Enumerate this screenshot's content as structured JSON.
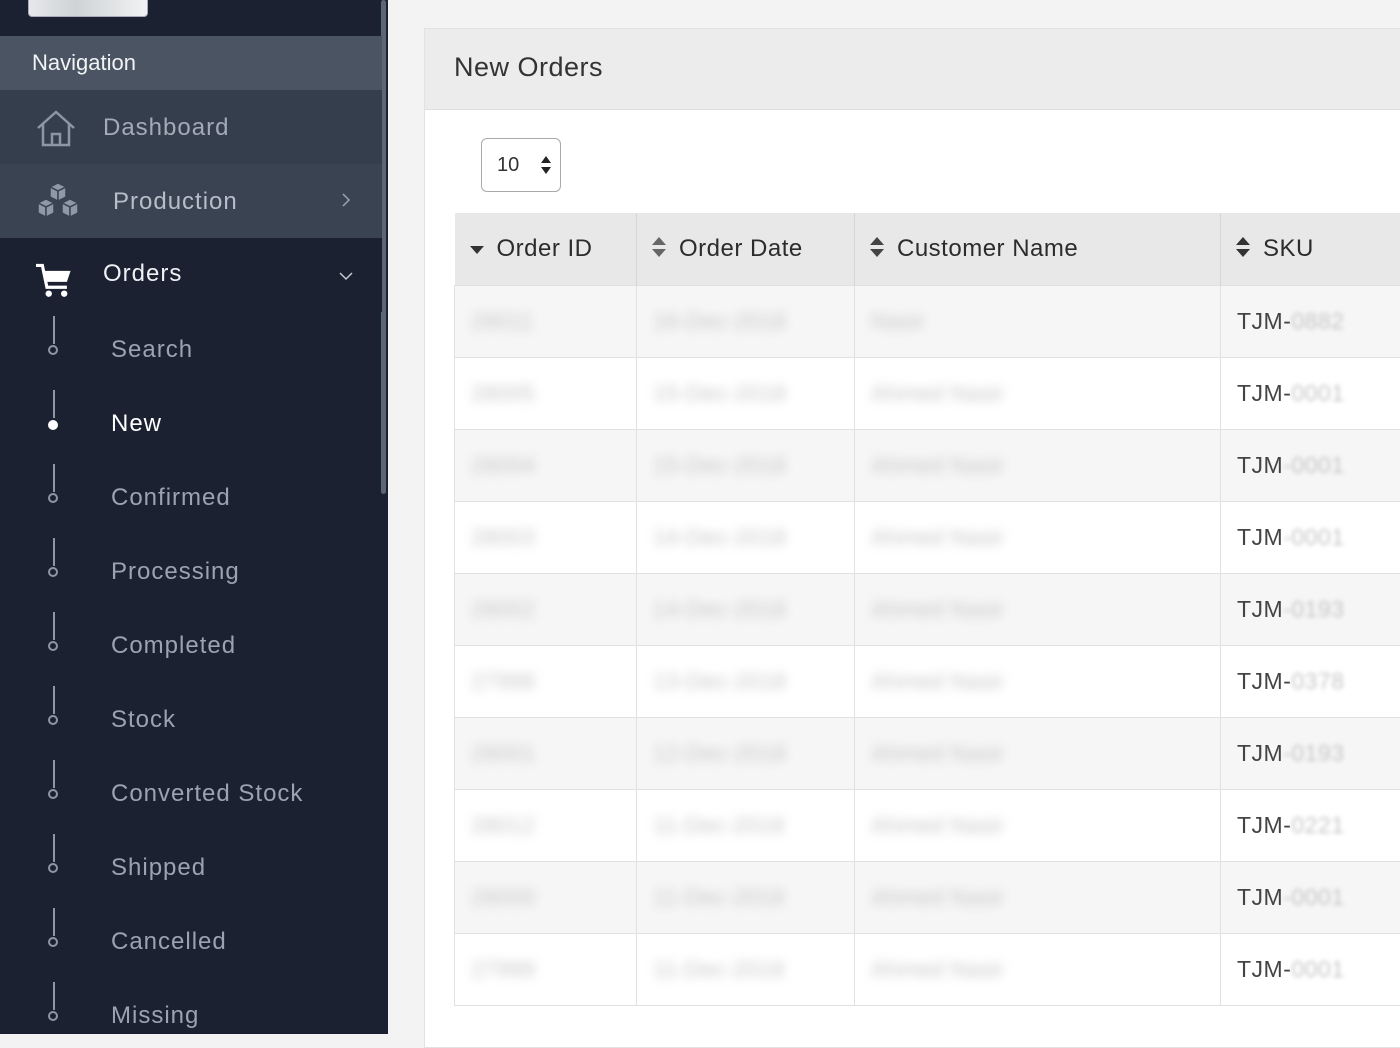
{
  "sidebar": {
    "header": "Navigation",
    "items": [
      {
        "label": "Dashboard",
        "icon": "home-icon"
      },
      {
        "label": "Production",
        "icon": "cubes-icon"
      },
      {
        "label": "Orders",
        "icon": "cart-icon",
        "expanded": true
      }
    ],
    "orders_sub": [
      {
        "label": "Search",
        "active": false
      },
      {
        "label": "New",
        "active": true
      },
      {
        "label": "Confirmed",
        "active": false
      },
      {
        "label": "Processing",
        "active": false
      },
      {
        "label": "Completed",
        "active": false
      },
      {
        "label": "Stock",
        "active": false
      },
      {
        "label": "Converted Stock",
        "active": false
      },
      {
        "label": "Shipped",
        "active": false
      },
      {
        "label": "Cancelled",
        "active": false
      },
      {
        "label": "Missing",
        "active": false
      }
    ]
  },
  "panel": {
    "title": "New Orders",
    "page_size": "10"
  },
  "table": {
    "columns": [
      "Order ID",
      "Order Date",
      "Customer Name",
      "SKU"
    ],
    "rows": [
      {
        "id": "28011",
        "date": "16-Dec-2018",
        "customer": "Nasir",
        "sku_prefix": "TJM-",
        "sku_tail": "0882"
      },
      {
        "id": "28005",
        "date": "15-Dec-2018",
        "customer": "Ahmed Nasir",
        "sku_prefix": "TJM-",
        "sku_tail": "0001"
      },
      {
        "id": "28004",
        "date": "15-Dec-2018",
        "customer": "Ahmed Nasir",
        "sku_prefix": "TJM",
        "sku_tail": "-0001"
      },
      {
        "id": "28003",
        "date": "14-Dec-2018",
        "customer": "Ahmed Nasir",
        "sku_prefix": "TJM",
        "sku_tail": "-0001"
      },
      {
        "id": "28002",
        "date": "14-Dec-2018",
        "customer": "Ahmed Nasir",
        "sku_prefix": "TJM",
        "sku_tail": "-0193"
      },
      {
        "id": "27998",
        "date": "13-Dec-2018",
        "customer": "Ahmed Nasir",
        "sku_prefix": "TJM-",
        "sku_tail": "0378"
      },
      {
        "id": "28001",
        "date": "12-Dec-2018",
        "customer": "Ahmed Nasir",
        "sku_prefix": "TJM",
        "sku_tail": "-0193"
      },
      {
        "id": "28012",
        "date": "11-Dec-2018",
        "customer": "Ahmed Nasir",
        "sku_prefix": "TJM-",
        "sku_tail": "0221"
      },
      {
        "id": "28000",
        "date": "11-Dec-2018",
        "customer": "Ahmed Nasir",
        "sku_prefix": "TJM",
        "sku_tail": "-0001"
      },
      {
        "id": "27999",
        "date": "11-Dec-2018",
        "customer": "Ahmed Nasir",
        "sku_prefix": "TJM-",
        "sku_tail": "0001"
      }
    ]
  },
  "colors": {
    "sidebar_bg": "#1b2130",
    "nav_header_bg": "#4a5463",
    "panel_bg": "#ffffff",
    "table_header_bg": "#e8e8e8"
  }
}
